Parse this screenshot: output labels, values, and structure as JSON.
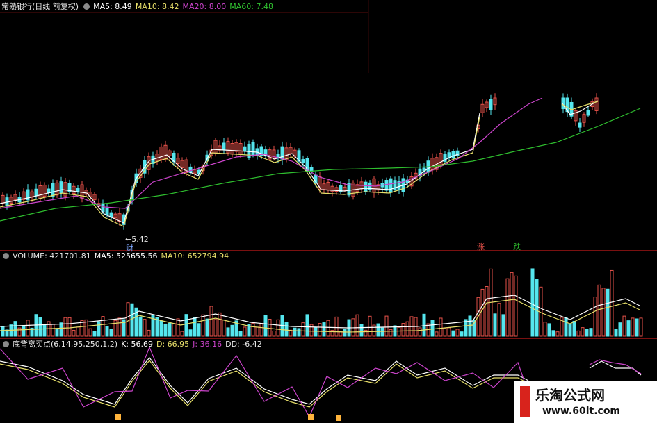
{
  "price_header": {
    "title": "常熟银行(日线 前复权)",
    "ma5": "MA5: 8.49",
    "ma10": "MA10: 8.42",
    "ma20": "MA20: 8.00",
    "ma60": "MA60: 7.48"
  },
  "volume_header": {
    "volume": "VOLUME: 421701.81",
    "ma5": "MA5: 525655.56",
    "ma10": "MA10: 652794.94"
  },
  "indicator_header": {
    "name": "底背离买点(6,14,95,250,1,2)",
    "k": "K: 56.69",
    "d": "D: 66.95",
    "j": "J: 36.16",
    "dd": "DD: -6.42"
  },
  "annotations": {
    "low_price": "←5.42",
    "cai_marker": "财",
    "zhang_marker": "涨",
    "die_marker": "跌"
  },
  "watermark": {
    "title": "乐淘公式网",
    "url": "www.60lt.com"
  },
  "colors": {
    "up": "#e8524a",
    "down": "#55e6ee",
    "ma5": "#ffffff",
    "ma10": "#e8e06a",
    "ma20": "#cc44cc",
    "ma60": "#2fbf2f",
    "k_line": "#ffffff",
    "d_line": "#e8e06a",
    "j_line": "#cc44cc",
    "buy_signal": "#ffb43c"
  },
  "chart_data": {
    "type": "candlestick",
    "price_labels": [
      "←5.42"
    ],
    "candles": [],
    "volume": [],
    "indicator": {}
  }
}
